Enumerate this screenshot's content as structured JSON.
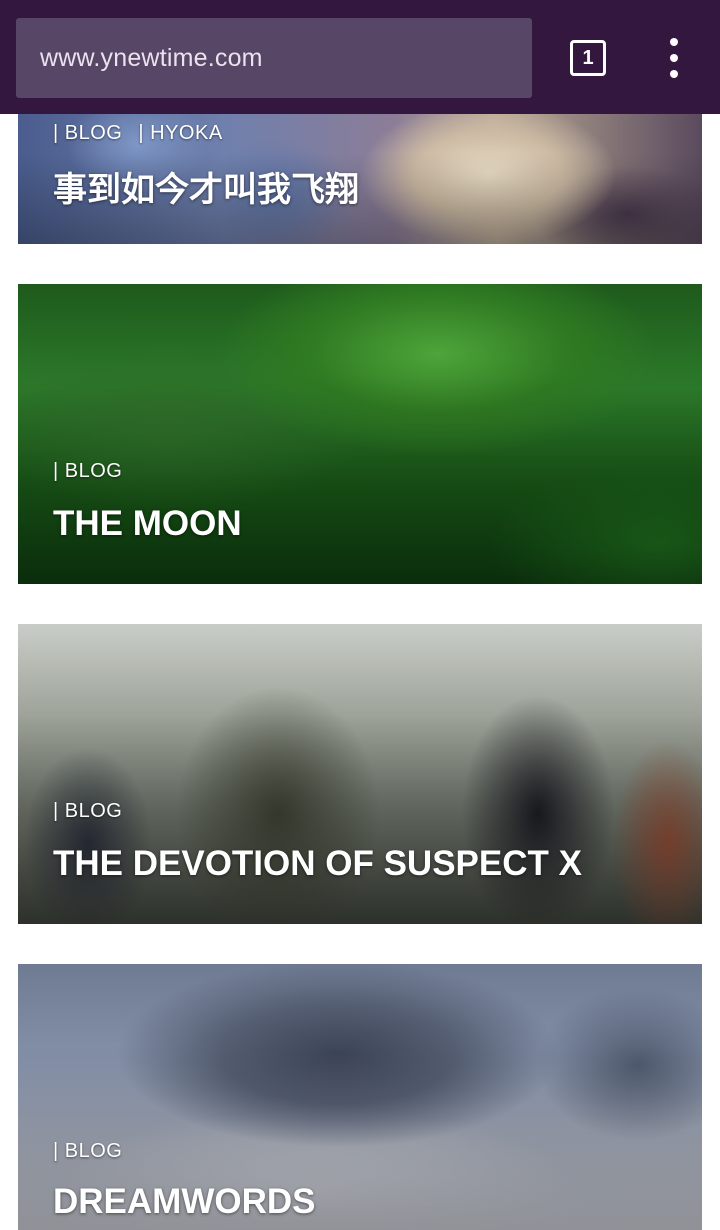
{
  "browser": {
    "url": "www.ynewtime.com",
    "tab_count": "1"
  },
  "cards": [
    {
      "tags": [
        "| BLOG",
        "| HYOKA"
      ],
      "title": "事到如今才叫我飞翔"
    },
    {
      "tags": [
        "| BLOG"
      ],
      "title": "THE MOON"
    },
    {
      "tags": [
        "| BLOG"
      ],
      "title": "THE DEVOTION OF SUSPECT X"
    },
    {
      "tags": [
        "| BLOG"
      ],
      "title": "DREAMWORDS"
    }
  ],
  "colors": {
    "toolbar": "#33173f",
    "url_bar": "#574665"
  }
}
